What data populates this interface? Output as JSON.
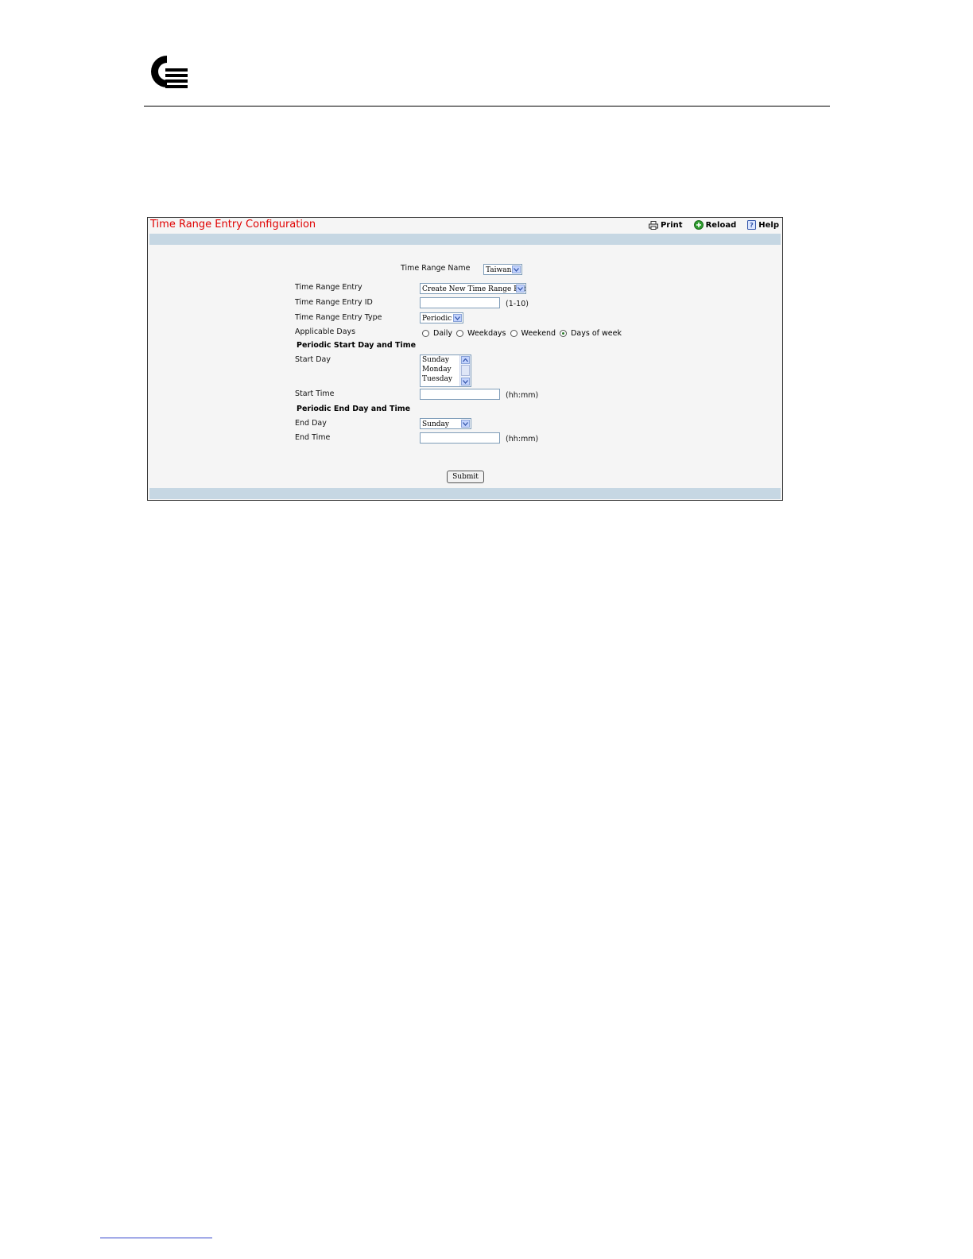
{
  "page": {
    "title": "Time Range Entry Configuration",
    "toolbar": {
      "print_label": "Print",
      "reload_label": "Reload",
      "help_label": "Help"
    }
  },
  "form": {
    "time_range_name": {
      "label": "Time Range Name",
      "value": "Taiwan"
    },
    "time_range_entry": {
      "label": "Time Range Entry",
      "value": "Create New Time Range Entry"
    },
    "time_range_entry_id": {
      "label": "Time Range Entry ID",
      "value": "",
      "hint": "(1-10)"
    },
    "time_range_entry_type": {
      "label": "Time Range Entry Type",
      "value": "Periodic"
    },
    "applicable_days": {
      "label": "Applicable Days",
      "options": [
        "Daily",
        "Weekdays",
        "Weekend",
        "Days of week"
      ],
      "selected": "Days of week"
    },
    "periodic_start_heading": "Periodic Start Day and Time",
    "start_day": {
      "label": "Start Day",
      "options": [
        "Sunday",
        "Monday",
        "Tuesday"
      ]
    },
    "start_time": {
      "label": "Start Time",
      "value": "",
      "hint": "(hh:mm)"
    },
    "periodic_end_heading": "Periodic End Day and Time",
    "end_day": {
      "label": "End Day",
      "value": "Sunday"
    },
    "end_time": {
      "label": "End Time",
      "value": "",
      "hint": "(hh:mm)"
    },
    "submit_label": "Submit"
  },
  "colors": {
    "title": "#e00000",
    "band": "#c6d7e3",
    "panel_background": "#f5f5f5"
  },
  "icons": [
    "logo-icon",
    "print-icon",
    "reload-icon",
    "help-icon",
    "chevron-down-icon",
    "chevron-up-icon"
  ]
}
